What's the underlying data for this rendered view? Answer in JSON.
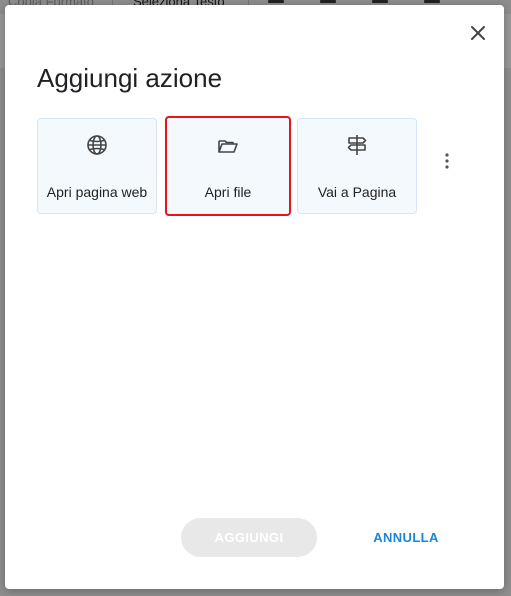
{
  "background_toolbar": {
    "items": [
      "Copia Formato",
      "Seleziona Testo"
    ]
  },
  "dialog": {
    "title": "Aggiungi azione",
    "close_icon": "close-icon",
    "actions": [
      {
        "label": "Apri pagina web",
        "icon": "globe-icon"
      },
      {
        "label": "Apri file",
        "icon": "folder-open-icon",
        "selected": true
      },
      {
        "label": "Vai a Pagina",
        "icon": "signpost-icon"
      }
    ],
    "more_icon": "more-vert-icon",
    "add_label": "AGGIUNGI",
    "cancel_label": "ANNULLA"
  },
  "colors": {
    "accent": "#1a85d9",
    "selected_border": "#e3151a",
    "tile_background": "#f4f9fd",
    "disabled_button": "#e8e8e8"
  }
}
